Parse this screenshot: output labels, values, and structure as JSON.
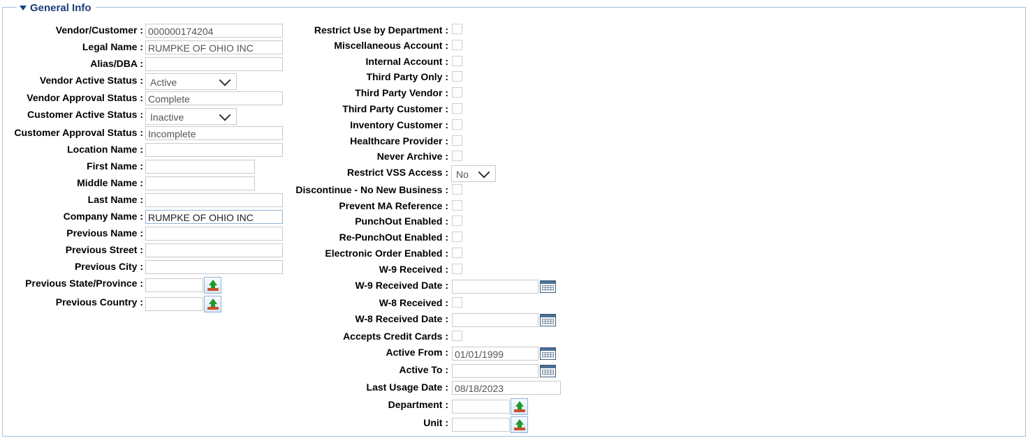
{
  "section": {
    "title": "General Info"
  },
  "left": {
    "vendor_customer": {
      "label": "Vendor/Customer :",
      "value": "000000174204"
    },
    "legal_name": {
      "label": "Legal Name :",
      "value": "RUMPKE OF OHIO INC"
    },
    "alias_dba": {
      "label": "Alias/DBA :",
      "value": ""
    },
    "vendor_active_status": {
      "label": "Vendor Active Status :",
      "value": "Active"
    },
    "vendor_approval_status": {
      "label": "Vendor Approval Status :",
      "value": "Complete"
    },
    "customer_active_status": {
      "label": "Customer Active Status :",
      "value": "Inactive"
    },
    "customer_approval_status": {
      "label": "Customer Approval Status :",
      "value": "Incomplete"
    },
    "location_name": {
      "label": "Location Name :",
      "value": ""
    },
    "first_name": {
      "label": "First Name :",
      "value": ""
    },
    "middle_name": {
      "label": "Middle Name :",
      "value": ""
    },
    "last_name": {
      "label": "Last Name :",
      "value": ""
    },
    "company_name": {
      "label": "Company Name :",
      "value": "RUMPKE OF OHIO INC"
    },
    "previous_name": {
      "label": "Previous Name :",
      "value": ""
    },
    "previous_street": {
      "label": "Previous Street :",
      "value": ""
    },
    "previous_city": {
      "label": "Previous City :",
      "value": ""
    },
    "previous_state": {
      "label": "Previous State/Province :",
      "value": ""
    },
    "previous_country": {
      "label": "Previous Country :",
      "value": ""
    }
  },
  "right": {
    "restrict_dept": {
      "label": "Restrict Use by Department :"
    },
    "misc_account": {
      "label": "Miscellaneous Account :"
    },
    "internal_account": {
      "label": "Internal Account :"
    },
    "third_party_only": {
      "label": "Third Party Only :"
    },
    "third_party_vendor": {
      "label": "Third Party Vendor :"
    },
    "third_party_customer": {
      "label": "Third Party Customer :"
    },
    "inventory_customer": {
      "label": "Inventory Customer :"
    },
    "healthcare_provider": {
      "label": "Healthcare Provider :"
    },
    "never_archive": {
      "label": "Never Archive :"
    },
    "restrict_vss": {
      "label": "Restrict VSS Access :",
      "value": "No"
    },
    "discontinue": {
      "label": "Discontinue - No New Business :"
    },
    "prevent_ma": {
      "label": "Prevent MA Reference :"
    },
    "punchout": {
      "label": "PunchOut Enabled :"
    },
    "repunchout": {
      "label": "Re-PunchOut Enabled :"
    },
    "electronic_order": {
      "label": "Electronic Order Enabled :"
    },
    "w9_received": {
      "label": "W-9 Received :"
    },
    "w9_date": {
      "label": "W-9 Received Date :",
      "value": ""
    },
    "w8_received": {
      "label": "W-8 Received :"
    },
    "w8_date": {
      "label": "W-8 Received Date :",
      "value": ""
    },
    "credit_cards": {
      "label": "Accepts Credit Cards :"
    },
    "active_from": {
      "label": "Active From :",
      "value": "01/01/1999"
    },
    "active_to": {
      "label": "Active To :",
      "value": ""
    },
    "last_usage": {
      "label": "Last Usage Date :",
      "value": "08/18/2023"
    },
    "department": {
      "label": "Department :",
      "value": ""
    },
    "unit": {
      "label": "Unit :",
      "value": ""
    }
  },
  "icons": {
    "section_toggle": "triangle-down-icon",
    "lookup": "upload-arrow-icon",
    "calendar": "calendar-icon"
  },
  "colors": {
    "section_title": "#1a3d7c",
    "border": "#a9c2dc",
    "lookup_arrow": "#1f9a2b"
  }
}
